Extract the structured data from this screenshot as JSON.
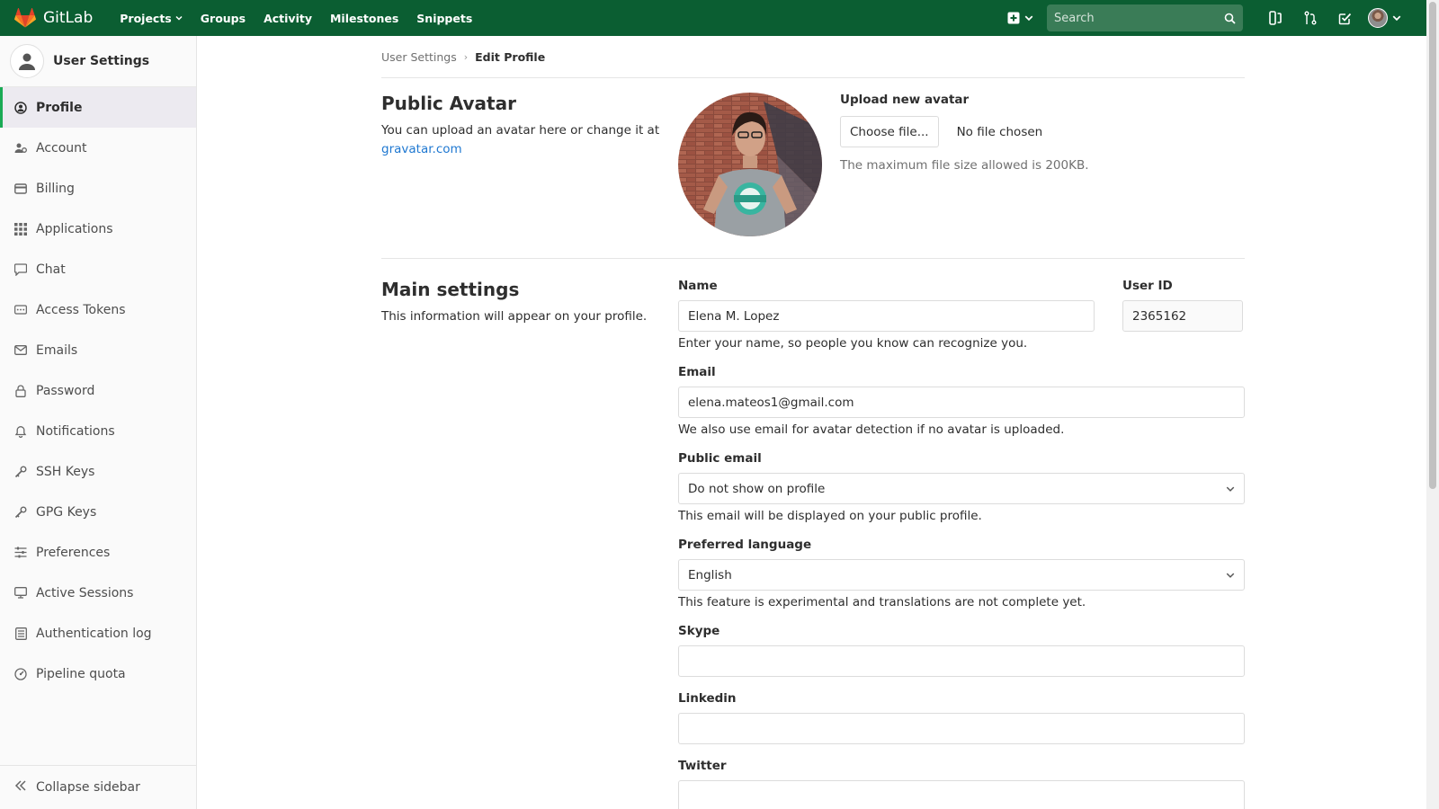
{
  "navbar": {
    "brand": "GitLab",
    "links": [
      {
        "label": "Projects",
        "dropdown": true
      },
      {
        "label": "Groups",
        "dropdown": false
      },
      {
        "label": "Activity",
        "dropdown": false
      },
      {
        "label": "Milestones",
        "dropdown": false
      },
      {
        "label": "Snippets",
        "dropdown": false
      }
    ],
    "search_placeholder": "Search"
  },
  "sidebar": {
    "title": "User Settings",
    "items": [
      {
        "label": "Profile",
        "icon": "profile-icon",
        "active": true
      },
      {
        "label": "Account",
        "icon": "account-icon"
      },
      {
        "label": "Billing",
        "icon": "credit-card-icon"
      },
      {
        "label": "Applications",
        "icon": "applications-grid-icon"
      },
      {
        "label": "Chat",
        "icon": "chat-bubble-icon"
      },
      {
        "label": "Access Tokens",
        "icon": "token-icon"
      },
      {
        "label": "Emails",
        "icon": "envelope-icon"
      },
      {
        "label": "Password",
        "icon": "lock-icon"
      },
      {
        "label": "Notifications",
        "icon": "bell-icon"
      },
      {
        "label": "SSH Keys",
        "icon": "key-icon"
      },
      {
        "label": "GPG Keys",
        "icon": "key-icon"
      },
      {
        "label": "Preferences",
        "icon": "sliders-icon"
      },
      {
        "label": "Active Sessions",
        "icon": "monitor-icon"
      },
      {
        "label": "Authentication log",
        "icon": "log-list-icon"
      },
      {
        "label": "Pipeline quota",
        "icon": "gauge-icon"
      }
    ],
    "collapse_label": "Collapse sidebar"
  },
  "breadcrumb": {
    "parent": "User Settings",
    "current": "Edit Profile"
  },
  "avatar_section": {
    "title": "Public Avatar",
    "desc": "You can upload an avatar here or change it at",
    "link": "gravatar.com",
    "upload_label": "Upload new avatar",
    "choose_button": "Choose file...",
    "no_file": "No file chosen",
    "max_size": "The maximum file size allowed is 200KB."
  },
  "main_settings": {
    "title": "Main settings",
    "desc": "This information will appear on your profile.",
    "name": {
      "label": "Name",
      "value": "Elena M. Lopez",
      "help": "Enter your name, so people you know can recognize you."
    },
    "user_id": {
      "label": "User ID",
      "value": "2365162"
    },
    "email": {
      "label": "Email",
      "value": "elena.mateos1@gmail.com",
      "help": "We also use email for avatar detection if no avatar is uploaded."
    },
    "public_email": {
      "label": "Public email",
      "value": "Do not show on profile",
      "help": "This email will be displayed on your public profile."
    },
    "language": {
      "label": "Preferred language",
      "value": "English",
      "help": "This feature is experimental and translations are not complete yet."
    },
    "skype": {
      "label": "Skype",
      "value": ""
    },
    "linkedin": {
      "label": "Linkedin",
      "value": ""
    },
    "twitter": {
      "label": "Twitter",
      "value": ""
    }
  },
  "colors": {
    "navbar": "#0b5e32",
    "active_indicator": "#1aaa55",
    "link": "#1f78d1"
  }
}
